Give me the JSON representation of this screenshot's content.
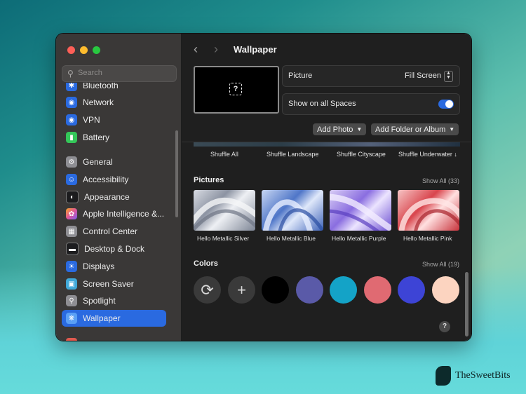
{
  "window_title": "Wallpaper",
  "search": {
    "placeholder": "Search"
  },
  "sidebar": {
    "items": [
      {
        "label": "Bluetooth",
        "icon": "bluetooth-icon",
        "color": "#2a6ae0"
      },
      {
        "label": "Network",
        "icon": "globe-icon",
        "color": "#2a6ae0"
      },
      {
        "label": "VPN",
        "icon": "globe-icon",
        "color": "#2a6ae0"
      },
      {
        "label": "Battery",
        "icon": "battery-icon",
        "color": "#34c759"
      },
      {
        "label": "General",
        "icon": "gear-icon",
        "color": "#8e8e93"
      },
      {
        "label": "Accessibility",
        "icon": "accessibility-icon",
        "color": "#2a6ae0"
      },
      {
        "label": "Appearance",
        "icon": "appearance-icon",
        "color": "#1c1c1e"
      },
      {
        "label": "Apple Intelligence &...",
        "icon": "apple-intelligence-icon",
        "color": "#e0569a"
      },
      {
        "label": "Control Center",
        "icon": "control-center-icon",
        "color": "#8e8e93"
      },
      {
        "label": "Desktop & Dock",
        "icon": "dock-icon",
        "color": "#1c1c1e"
      },
      {
        "label": "Displays",
        "icon": "sun-icon",
        "color": "#2a6ae0"
      },
      {
        "label": "Screen Saver",
        "icon": "screen-saver-icon",
        "color": "#40a8d8"
      },
      {
        "label": "Spotlight",
        "icon": "magnifier-icon",
        "color": "#8e8e93"
      },
      {
        "label": "Wallpaper",
        "icon": "wallpaper-icon",
        "color": "#2a6ae0"
      }
    ],
    "selected": "Wallpaper"
  },
  "options": {
    "picture_label": "Picture",
    "picture_value": "Fill Screen",
    "spaces_label": "Show on all Spaces",
    "spaces_on": true
  },
  "buttons": {
    "add_photo": "Add Photo",
    "add_folder": "Add Folder or Album"
  },
  "shuffle": [
    "Shuffle All",
    "Shuffle Landscape",
    "Shuffle Cityscape",
    "Shuffle Underwater ↓"
  ],
  "pictures": {
    "title": "Pictures",
    "show_all": "Show All (33)",
    "items": [
      {
        "label": "Hello Metallic Silver",
        "c1": "#d8dbe2",
        "c2": "#7d8595"
      },
      {
        "label": "Hello Metallic Blue",
        "c1": "#c7d6f2",
        "c2": "#3e63b8"
      },
      {
        "label": "Hello Metallic Purple",
        "c1": "#d9cdf5",
        "c2": "#6b4ed0"
      },
      {
        "label": "Hello Metallic Pink",
        "c1": "#f6c4c4",
        "c2": "#c8323b"
      }
    ]
  },
  "colors": {
    "title": "Colors",
    "show_all": "Show All (19)",
    "swatches": [
      "#000000",
      "#5a5aa8",
      "#14a3c7",
      "#e06a72",
      "#3d44d6",
      "#fcd4c0"
    ]
  },
  "brand": "TheSweetBits"
}
